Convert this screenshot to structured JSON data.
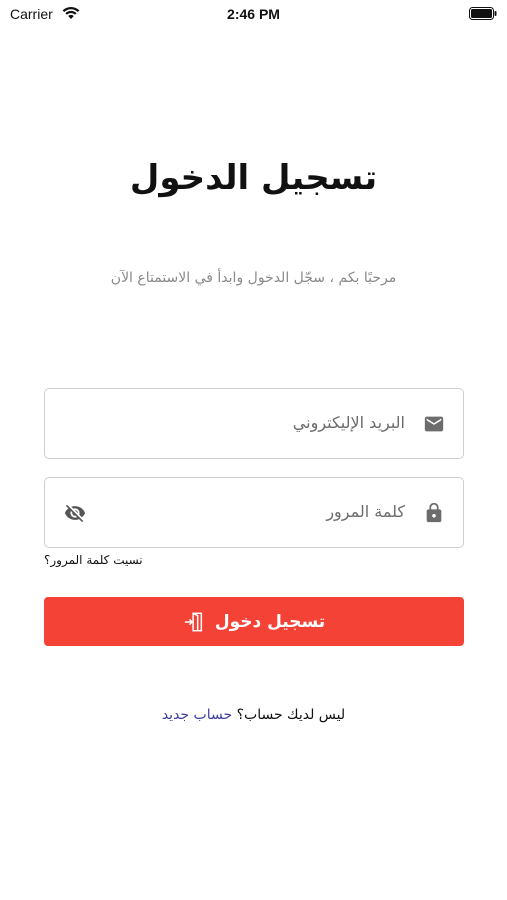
{
  "status_bar": {
    "carrier": "Carrier",
    "time": "2:46 PM"
  },
  "login": {
    "title": "تسجيل الدخول",
    "subtitle": "مرحبًا بكم ، سجّل الدخول وابدأ في الاستمتاع الآن",
    "email": {
      "placeholder": "البريد الإليكتروني",
      "icon": "mail-icon"
    },
    "password": {
      "placeholder": "كلمة المرور",
      "icon": "lock-icon",
      "toggle_icon": "eye-off-icon"
    },
    "forgot_password": "نسيت كلمة المرور؟",
    "submit_label": "تسجيل دخول",
    "submit_icon": "login-door-icon",
    "signup_prompt": "ليس لديك حساب؟",
    "signup_link": "حساب جديد"
  },
  "colors": {
    "accent": "#f44336",
    "link": "#3b3f9c",
    "muted": "#8a8a8a",
    "border": "#cfcfcf"
  }
}
